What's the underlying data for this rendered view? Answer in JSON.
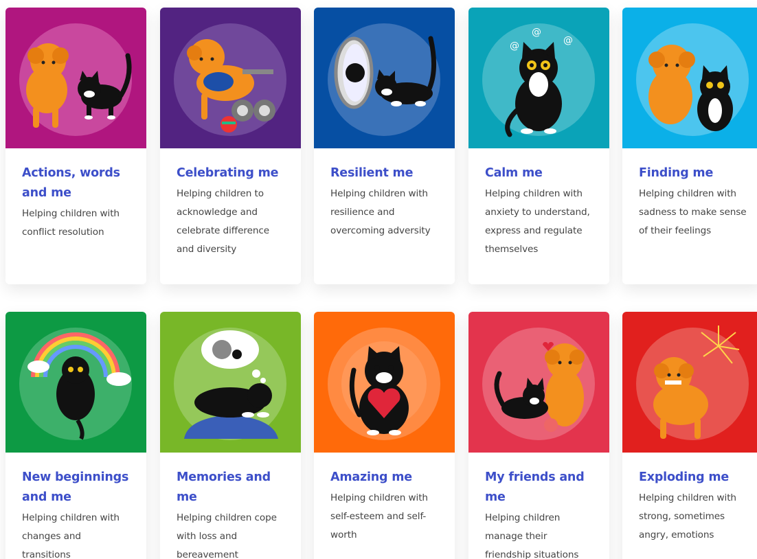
{
  "cards": [
    {
      "title": "Actions, words and me",
      "desc": "Helping children with conflict resolution",
      "bg": "#b0167f",
      "circle": "#c9489e",
      "icon": "dog-and-cat-icon"
    },
    {
      "title": "Celebrating me",
      "desc": "Helping children to acknowledge and celebrate difference and diversity",
      "bg": "#522381",
      "circle": "#70489b",
      "icon": "dog-wheelchair-icon"
    },
    {
      "title": "Resilient me",
      "desc": "Helping children with resilience and overcoming adversity",
      "bg": "#064fa3",
      "circle": "#3a72b8",
      "icon": "cat-mirror-icon"
    },
    {
      "title": "Calm me",
      "desc": "Helping children with anxiety to understand, express and regulate themselves",
      "bg": "#0aa3b8",
      "circle": "#40b9c8",
      "icon": "anxious-cat-icon"
    },
    {
      "title": "Finding me",
      "desc": "Helping children with sadness to make sense of their feelings",
      "bg": "#0bb0e8",
      "circle": "#4cc5ee",
      "icon": "sad-dog-and-cat-icon"
    },
    {
      "title": "New beginnings and me",
      "desc": "Helping children with changes and transitions",
      "bg": "#0d9a44",
      "circle": "#3db06a",
      "icon": "cat-rainbow-icon"
    },
    {
      "title": "Memories and me",
      "desc": "Helping children cope with loss and bereavement",
      "bg": "#78b728",
      "circle": "#95c85a",
      "icon": "cat-dreaming-icon"
    },
    {
      "title": "Amazing me",
      "desc": "Helping children with self-esteem and self-worth",
      "bg": "#ff6a0a",
      "circle": "#ff8a42",
      "icon": "cat-heart-icon"
    },
    {
      "title": "My friends and me",
      "desc": "Helping children manage their friendship situations",
      "bg": "#e3344d",
      "circle": "#ea6175",
      "icon": "dog-and-cat-friends-icon"
    },
    {
      "title": "Exploding me",
      "desc": "Helping children with strong, sometimes angry, emotions",
      "bg": "#e1201e",
      "circle": "#e8544f",
      "icon": "angry-dog-fireworks-icon"
    }
  ]
}
